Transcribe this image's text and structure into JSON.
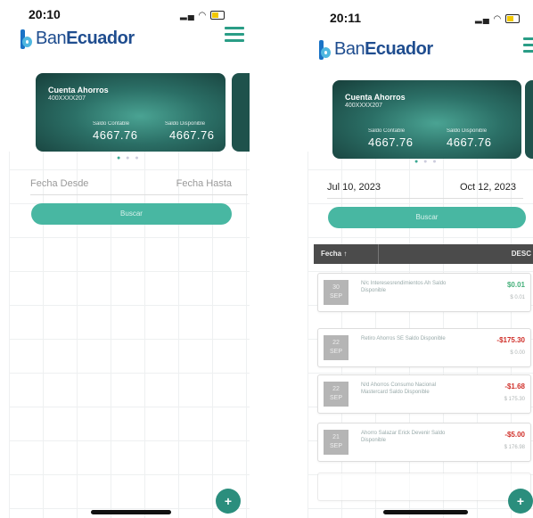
{
  "left": {
    "time": "20:10",
    "brand": {
      "prefix": "Ban",
      "suffix": "Ecuador"
    },
    "card": {
      "type": "Cuenta Ahorros",
      "number": "400XXXX207",
      "label_contable": "Saldo Contable",
      "label_disponible": "Saldo Disponible",
      "contable": "4667.76",
      "disponible": "4667.76"
    },
    "date_from": "Fecha Desde",
    "date_to": "Fecha Hasta",
    "search_label": "Buscar"
  },
  "right": {
    "time": "20:11",
    "brand": {
      "prefix": "Ban",
      "suffix": "Ecuador"
    },
    "card": {
      "type": "Cuenta Ahorros",
      "number": "400XXXX207",
      "label_contable": "Saldo Contable",
      "label_disponible": "Saldo Disponible",
      "contable": "4667.76",
      "disponible": "4667.76"
    },
    "date_from": "Jul 10, 2023",
    "date_to": "Oct 12, 2023",
    "search_label": "Buscar",
    "table_header": {
      "date": "Fecha ↑",
      "desc": "DESC"
    },
    "transactions": [
      {
        "day": "30",
        "month": "SEP",
        "desc": "N/c Interesesrendimientos Ah Saldo Disponible",
        "amount": "$0.01",
        "balance": "$ 0.01"
      },
      {
        "day": "22",
        "month": "SEP",
        "desc": "Retiro Ahorros SE Saldo Disponible",
        "amount": "-$175.30",
        "balance": "$ 0.00"
      },
      {
        "day": "22",
        "month": "SEP",
        "desc": "N/d Ahorros Consumo Nacional Mastercard Saldo Disponible",
        "amount": "-$1.68",
        "balance": "$ 175.30"
      },
      {
        "day": "21",
        "month": "SEP",
        "desc": "Ahorro Salazar Erick Devenir Saldo Disponible",
        "amount": "-$5.00",
        "balance": "$ 176.98"
      }
    ]
  },
  "colors": {
    "accent": "#48b7a2",
    "negative": "#d0302a",
    "positive": "#45b07a",
    "card_dark": "#173f3b"
  }
}
